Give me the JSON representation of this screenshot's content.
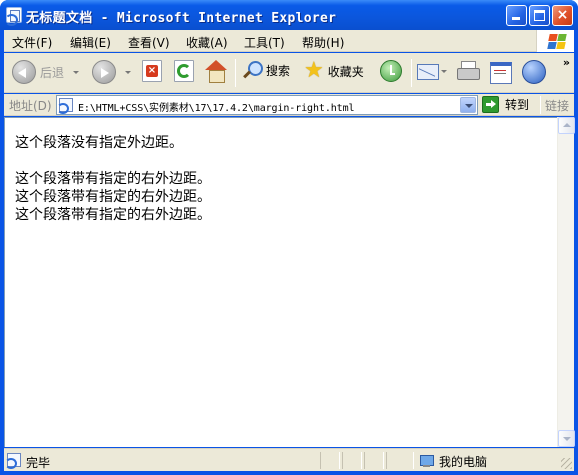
{
  "window": {
    "title": "无标题文档 - Microsoft Internet Explorer",
    "controls": {
      "minimize_icon": "minimize-icon",
      "maximize_icon": "maximize-icon",
      "close_glyph": "×"
    }
  },
  "menu": {
    "items": [
      "文件(F)",
      "编辑(E)",
      "查看(V)",
      "收藏(A)",
      "工具(T)",
      "帮助(H)"
    ]
  },
  "toolbar": {
    "back_label": "后退",
    "search_label": "搜索",
    "favorites_label": "收藏夹",
    "more_glyph": "»"
  },
  "address": {
    "label": "地址(D)",
    "value": "E:\\HTML+CSS\\实例素材\\17\\17.4.2\\margin-right.html",
    "go_label": "转到",
    "links_label": "链接"
  },
  "content": {
    "paragraphs": [
      "这个段落没有指定外边距。",
      "这个段落带有指定的右外边距。",
      "这个段落带有指定的右外边距。",
      "这个段落带有指定的右外边距。"
    ]
  },
  "status": {
    "text": "完毕",
    "zone": "我的电脑"
  },
  "colors": {
    "titlebar": "#0a5be8",
    "chrome": "#ece9d8",
    "close_button": "#e0512a"
  }
}
